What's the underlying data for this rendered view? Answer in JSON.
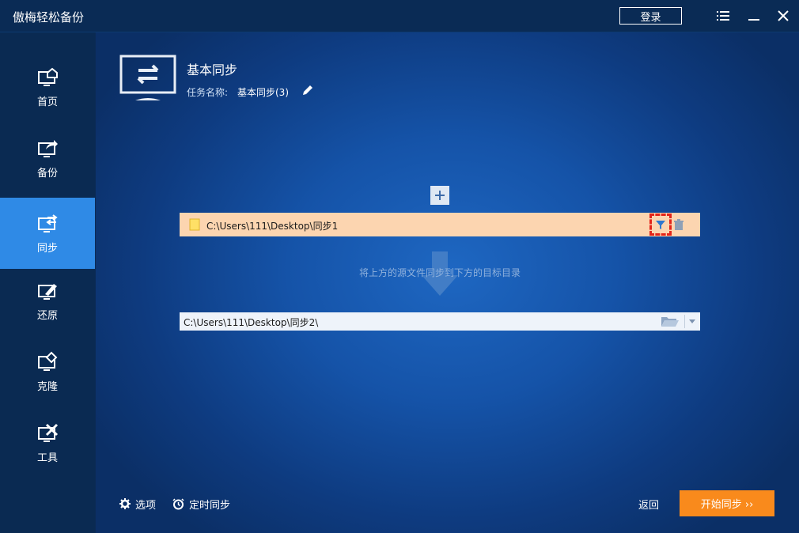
{
  "app": {
    "title": "傲梅轻松备份"
  },
  "titlebar": {
    "login_label": "登录"
  },
  "sidebar": {
    "items": [
      {
        "label": "首页",
        "icon": "home-icon"
      },
      {
        "label": "备份",
        "icon": "backup-icon"
      },
      {
        "label": "同步",
        "icon": "sync-icon",
        "active": true
      },
      {
        "label": "还原",
        "icon": "restore-icon"
      },
      {
        "label": "克隆",
        "icon": "clone-icon"
      },
      {
        "label": "工具",
        "icon": "tools-icon"
      }
    ]
  },
  "header": {
    "title": "基本同步",
    "task_label": "任务名称:",
    "task_name": "基本同步(3)"
  },
  "source": {
    "path": "C:\\Users\\111\\Desktop\\同步1"
  },
  "hint": "将上方的源文件同步到下方的目标目录",
  "destination": {
    "path": "C:\\Users\\111\\Desktop\\同步2\\"
  },
  "footer": {
    "options_label": "选项",
    "schedule_label": "定时同步",
    "back_label": "返回",
    "start_label": "开始同步 ››"
  },
  "colors": {
    "accent": "#2f8ae6",
    "start_button": "#f98a1c",
    "source_row": "#fcd5b0",
    "filter_highlight": "#e3241a"
  }
}
